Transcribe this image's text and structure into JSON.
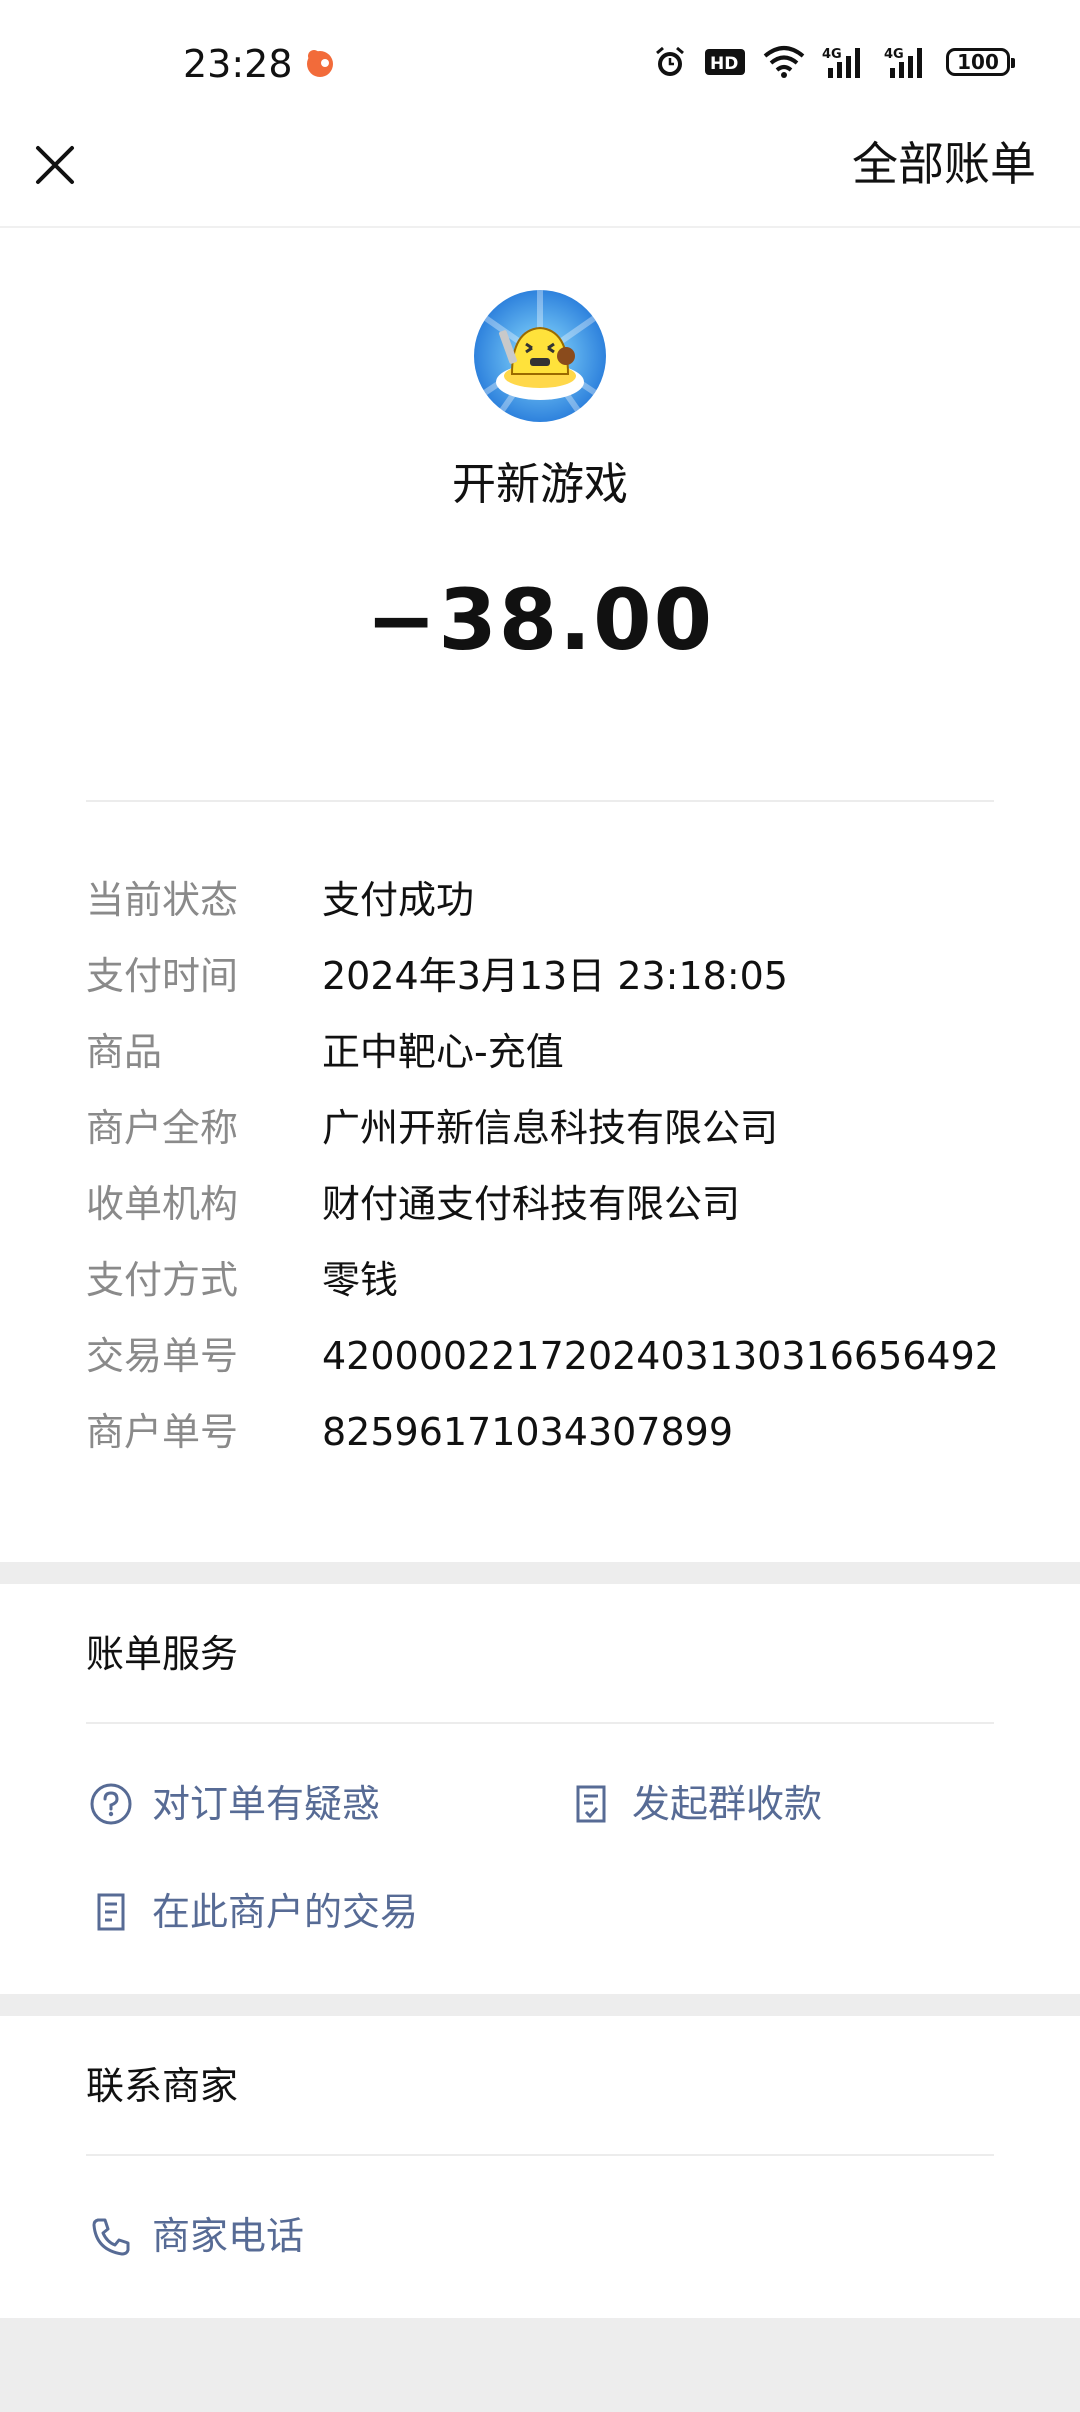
{
  "status_bar": {
    "time": "23:28",
    "battery": "100",
    "icons": [
      "alarm-icon",
      "hd-icon",
      "wifi-icon",
      "signal-4g-icon",
      "signal-4g-icon",
      "battery-icon"
    ]
  },
  "nav": {
    "close_icon": "close-icon",
    "all_bills_label": "全部账单"
  },
  "merchant": {
    "name": "开新游戏",
    "amount": "−38.00"
  },
  "details": [
    {
      "label": "当前状态",
      "value": "支付成功"
    },
    {
      "label": "支付时间",
      "value": "2024年3月13日 23:18:05"
    },
    {
      "label": "商品",
      "value": "正中靶心-充值"
    },
    {
      "label": "商户全称",
      "value": "广州开新信息科技有限公司"
    },
    {
      "label": "收单机构",
      "value": "财付通支付科技有限公司"
    },
    {
      "label": "支付方式",
      "value": "零钱"
    },
    {
      "label": "交易单号",
      "value": "4200002217202403130316656492"
    },
    {
      "label": "商户单号",
      "value": "82596171034307899"
    }
  ],
  "bill_services": {
    "title": "账单服务",
    "actions": [
      {
        "label": "对订单有疑惑",
        "icon": "question-circle-icon"
      },
      {
        "label": "发起群收款",
        "icon": "group-receipt-icon"
      },
      {
        "label": "在此商户的交易",
        "icon": "document-icon"
      }
    ]
  },
  "contact": {
    "title": "联系商家",
    "phone_label": "商家电话",
    "phone_icon": "phone-icon"
  },
  "colors": {
    "link": "#576b95",
    "label_gray": "#8a8a8a",
    "band_gray": "#ededed"
  }
}
